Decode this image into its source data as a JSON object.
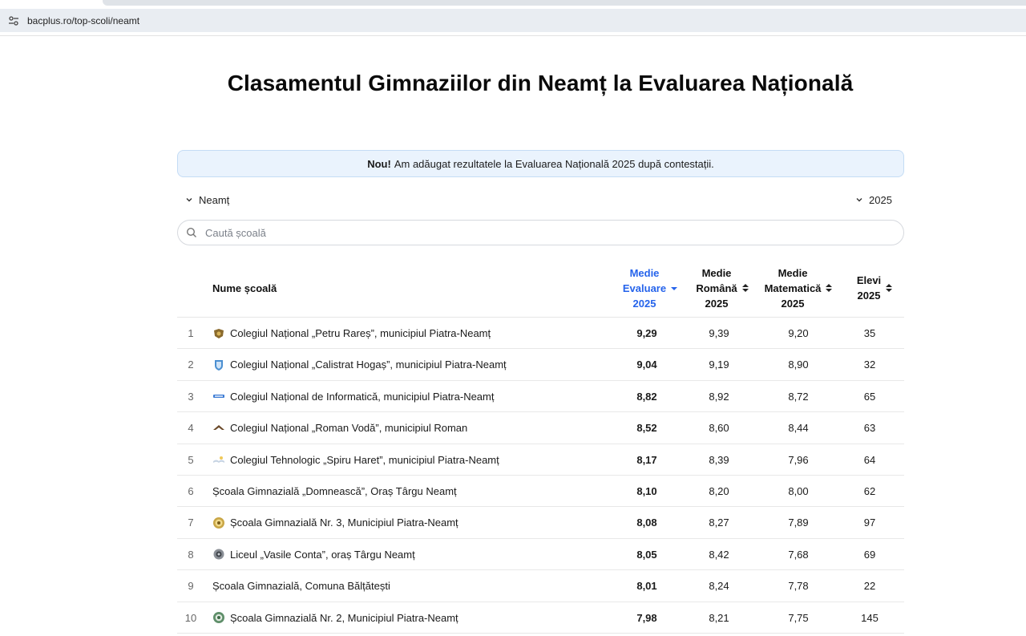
{
  "browser": {
    "url": "bacplus.ro/top-scoli/neamt"
  },
  "page": {
    "title": "Clasamentul Gimnaziilor din Neamț la Evaluarea Națională"
  },
  "notice": {
    "bold": "Nou!",
    "text": "Am adăugat rezultatele la Evaluarea Națională 2025 după contestații."
  },
  "filters": {
    "county": "Neamț",
    "year": "2025"
  },
  "search": {
    "placeholder": "Caută școală",
    "value": ""
  },
  "colors": {
    "accent": "#2563eb",
    "notice_bg": "#eaf3fd"
  },
  "table": {
    "columns": {
      "name": "Nume școală",
      "eval": [
        "Medie",
        "Evaluare",
        "2025"
      ],
      "romana": [
        "Medie",
        "Română",
        "2025"
      ],
      "mate": [
        "Medie",
        "Matematică",
        "2025"
      ],
      "elevi": [
        "Elevi",
        "2025"
      ]
    },
    "sorted_by": "eval",
    "sort_direction": "desc",
    "rows": [
      {
        "rank": "1",
        "name": "Colegiul Național „Petru Rareș”, municipiul Piatra-Neamț",
        "logo": "crest-brown",
        "eval": "9,29",
        "romana": "9,39",
        "mate": "9,20",
        "elevi": "35"
      },
      {
        "rank": "2",
        "name": "Colegiul Național „Calistrat Hogaș”, municipiul Piatra-Neamț",
        "logo": "shield-blue",
        "eval": "9,04",
        "romana": "9,19",
        "mate": "8,90",
        "elevi": "32"
      },
      {
        "rank": "3",
        "name": "Colegiul Național de Informatică, municipiul Piatra-Neamț",
        "logo": "banner-blue",
        "eval": "8,82",
        "romana": "8,92",
        "mate": "8,72",
        "elevi": "65"
      },
      {
        "rank": "4",
        "name": "Colegiul Național „Roman Vodă”, municipiul Roman",
        "logo": "eagle-brown",
        "eval": "8,52",
        "romana": "8,60",
        "mate": "8,44",
        "elevi": "63"
      },
      {
        "rank": "5",
        "name": "Colegiul Tehnologic „Spiru Haret”, municipiul Piatra-Neamț",
        "logo": "book-light",
        "eval": "8,17",
        "romana": "8,39",
        "mate": "7,96",
        "elevi": "64"
      },
      {
        "rank": "6",
        "name": "Școala Gimnazială „Domnească”, Oraș Târgu Neamț",
        "logo": "",
        "eval": "8,10",
        "romana": "8,20",
        "mate": "8,00",
        "elevi": "62"
      },
      {
        "rank": "7",
        "name": "Școala Gimnazială Nr. 3, Municipiul Piatra-Neamț",
        "logo": "medal-gold",
        "eval": "8,08",
        "romana": "8,27",
        "mate": "7,89",
        "elevi": "97"
      },
      {
        "rank": "8",
        "name": "Liceul „Vasile Conta”, oraș Târgu Neamț",
        "logo": "gear-grey",
        "eval": "8,05",
        "romana": "8,42",
        "mate": "7,68",
        "elevi": "69"
      },
      {
        "rank": "9",
        "name": "Școala Gimnazială, Comuna Bălțătești",
        "logo": "",
        "eval": "8,01",
        "romana": "8,24",
        "mate": "7,78",
        "elevi": "22"
      },
      {
        "rank": "10",
        "name": "Școala Gimnazială Nr. 2, Municipiul Piatra-Neamț",
        "logo": "wreath-green",
        "eval": "7,98",
        "romana": "8,21",
        "mate": "7,75",
        "elevi": "145"
      }
    ]
  }
}
